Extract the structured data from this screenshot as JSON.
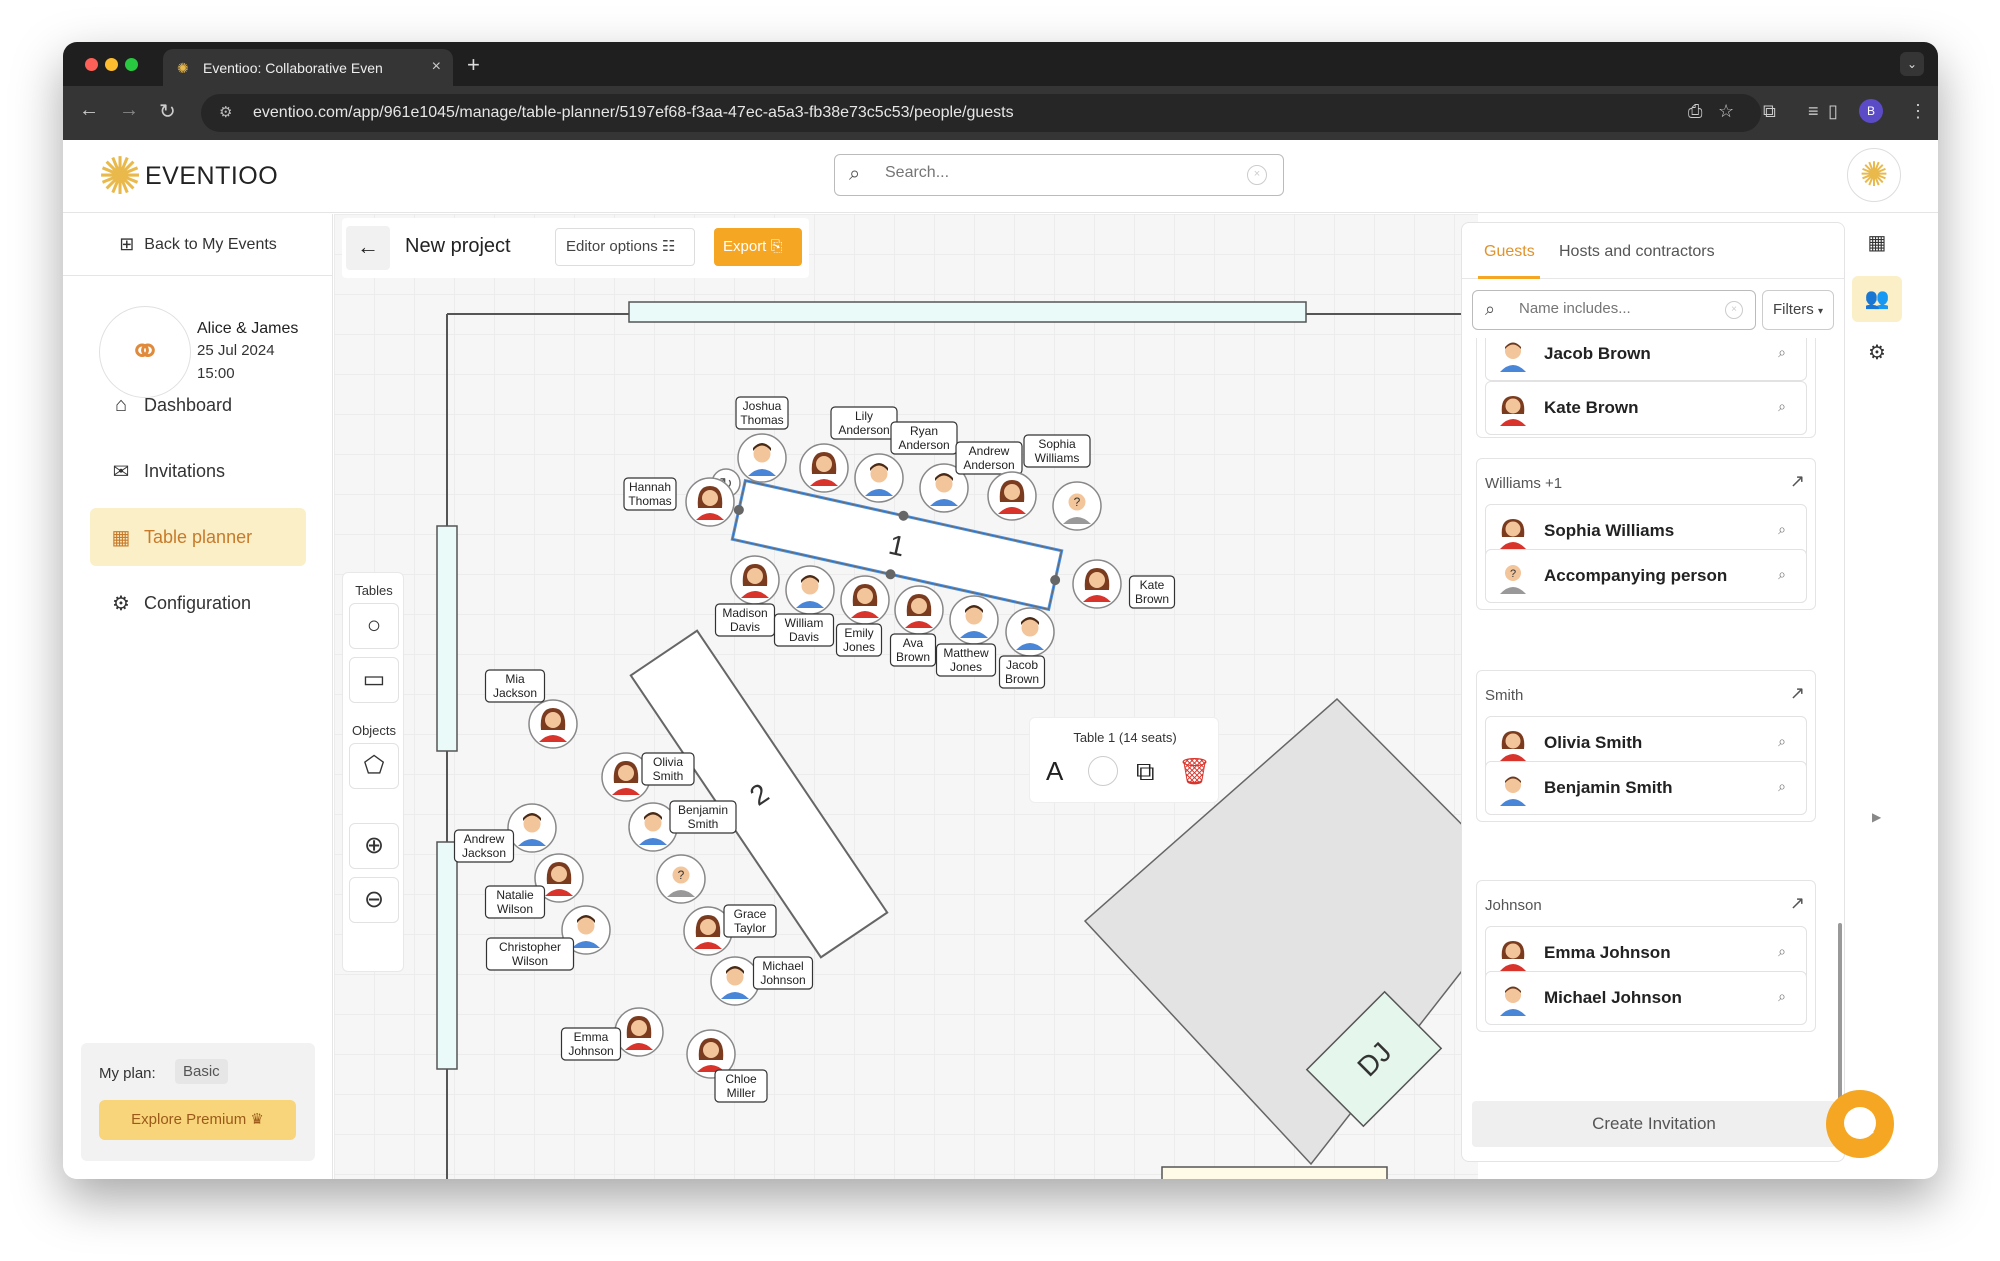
{
  "browser": {
    "tab_title": "Eventioo: Collaborative Even",
    "url": "eventioo.com/app/961e1045/manage/table-planner/5197ef68-f3aa-47ec-a5a3-fb38e73c5c53/people/guests",
    "profile_initial": "B"
  },
  "header": {
    "brand": "EVENTIOO",
    "search_placeholder": "Search..."
  },
  "sidebar": {
    "back_label": "Back to My Events",
    "event_names": "Alice & James",
    "event_date": "25 Jul 2024",
    "event_time": "15:00",
    "nav": [
      {
        "label": "Dashboard",
        "icon": "home-icon",
        "active": false
      },
      {
        "label": "Invitations",
        "icon": "envelope-icon",
        "active": false
      },
      {
        "label": "Table planner",
        "icon": "grid-icon",
        "active": true
      },
      {
        "label": "Configuration",
        "icon": "gear-icon",
        "active": false
      }
    ],
    "plan_label": "My plan:",
    "plan_value": "Basic",
    "premium_label": "Explore Premium"
  },
  "toolbar": {
    "project_title": "New project",
    "editor_options": "Editor options",
    "export": "Export"
  },
  "tools": {
    "tables_label": "Tables",
    "objects_label": "Objects"
  },
  "selection": {
    "title": "Table 1 (14 seats)",
    "font_glyph": "A"
  },
  "floor": {
    "table1_number": "1",
    "table2_number": "2",
    "dj_label": "DJ",
    "table1_guests": [
      {
        "name": [
          "Hannah",
          "Thomas"
        ],
        "gender": "f"
      },
      {
        "name": [
          "Joshua",
          "Thomas"
        ],
        "gender": "m"
      },
      {
        "name": [
          "Lily",
          "Anderson"
        ],
        "gender": "f"
      },
      {
        "name": [
          "Ryan",
          "Anderson"
        ],
        "gender": "m"
      },
      {
        "name": [
          "Andrew",
          "Anderson"
        ],
        "gender": "m"
      },
      {
        "name": [
          "Sophia",
          "Williams"
        ],
        "gender": "f"
      },
      {
        "name": [],
        "gender": "u"
      },
      {
        "name": [
          "Kate",
          "Brown"
        ],
        "gender": "f"
      },
      {
        "name": [
          "Madison",
          "Davis"
        ],
        "gender": "f"
      },
      {
        "name": [
          "William",
          "Davis"
        ],
        "gender": "m"
      },
      {
        "name": [
          "Emily",
          "Jones"
        ],
        "gender": "f"
      },
      {
        "name": [
          "Ava",
          "Brown"
        ],
        "gender": "f"
      },
      {
        "name": [
          "Matthew",
          "Jones"
        ],
        "gender": "m"
      },
      {
        "name": [
          "Jacob",
          "Brown"
        ],
        "gender": "m"
      }
    ],
    "table2_guests": [
      {
        "name": [
          "Mia",
          "Jackson"
        ],
        "gender": "f"
      },
      {
        "name": [
          "Andrew",
          "Jackson"
        ],
        "gender": "m"
      },
      {
        "name": [
          "Natalie",
          "Wilson"
        ],
        "gender": "f"
      },
      {
        "name": [
          "Christopher",
          "Wilson"
        ],
        "gender": "m"
      },
      {
        "name": [
          "Emma",
          "Johnson"
        ],
        "gender": "f"
      },
      {
        "name": [
          "Olivia",
          "Smith"
        ],
        "gender": "f"
      },
      {
        "name": [
          "Benjamin",
          "Smith"
        ],
        "gender": "m"
      },
      {
        "name": [],
        "gender": "u"
      },
      {
        "name": [
          "Grace",
          "Taylor"
        ],
        "gender": "f"
      },
      {
        "name": [
          "Michael",
          "Johnson"
        ],
        "gender": "m"
      },
      {
        "name": [
          "Chloe",
          "Miller"
        ],
        "gender": "f"
      }
    ]
  },
  "guests_panel": {
    "tab_guests": "Guests",
    "tab_hosts": "Hosts and contractors",
    "filter_placeholder": "Name includes...",
    "filters_label": "Filters",
    "partial_name": "Jacob Brown",
    "kate": "Kate Brown",
    "groups": [
      {
        "title": "Williams +1",
        "guests": [
          {
            "name": "Sophia Williams",
            "gender": "f"
          },
          {
            "name": "Accompanying person",
            "gender": "u"
          }
        ]
      },
      {
        "title": "Smith",
        "guests": [
          {
            "name": "Olivia Smith",
            "gender": "f"
          },
          {
            "name": "Benjamin Smith",
            "gender": "m"
          }
        ]
      },
      {
        "title": "Johnson",
        "guests": [
          {
            "name": "Emma Johnson",
            "gender": "f"
          },
          {
            "name": "Michael Johnson",
            "gender": "m"
          }
        ]
      }
    ],
    "create_invitation": "Create Invitation"
  },
  "colors": {
    "accent": "#f5a623",
    "active_bg": "#fbefc8",
    "active_text": "#c77a2a",
    "table_border": "#666666",
    "wall_fill": "#eafaf8"
  }
}
